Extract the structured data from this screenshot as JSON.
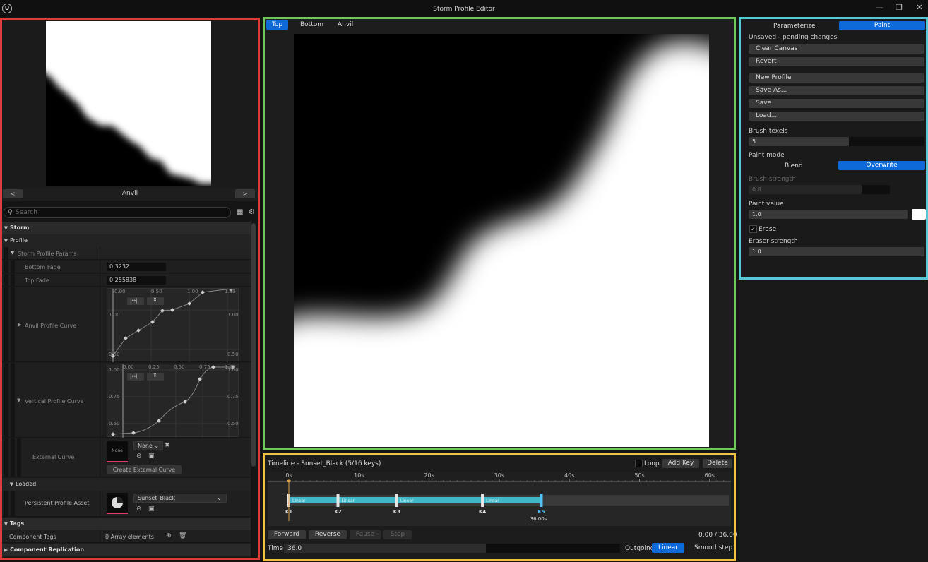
{
  "window": {
    "title": "Storm Profile Editor",
    "logo": "U",
    "minimize_glyph": "—",
    "restore_glyph": "❐",
    "close_glyph": "✕"
  },
  "left_panel": {
    "preview": {
      "name": "Anvil",
      "prev_label": "<",
      "next_label": ">"
    },
    "search": {
      "placeholder": "Search"
    },
    "categories": {
      "storm": "Storm",
      "profile": "Profile",
      "storm_profile_params": "Storm Profile Params",
      "loaded": "Loaded",
      "tags": "Tags",
      "component_replication": "Component Replication"
    },
    "properties": {
      "bottom_fade": {
        "label": "Bottom Fade",
        "value": "0.3232"
      },
      "top_fade": {
        "label": "Top Fade",
        "value": "0.255838"
      },
      "anvil_curve": {
        "label": "Anvil Profile Curve",
        "x_ticks": [
          "0.00",
          "0.50",
          "1.00",
          "1.50"
        ],
        "y_ticks": [
          "1.00",
          "0.50"
        ],
        "y_ticks_right": [
          "1.00",
          "0.50"
        ]
      },
      "vertical_curve": {
        "label": "Vertical Profile Curve",
        "x_ticks": [
          "0.00",
          "0.25",
          "0.50",
          "0.75",
          "1.00"
        ],
        "y_ticks": [
          "1.00",
          "0.75",
          "0.50"
        ],
        "y_ticks_right": [
          "1.00",
          "0.75",
          "0.50"
        ]
      },
      "external_curve": {
        "label": "External Curve",
        "thumb_text": "None",
        "combo_value": "None",
        "create_button": "Create External Curve"
      },
      "persistent_asset": {
        "label": "Persistent Profile Asset",
        "value": "Sunset_Black"
      },
      "component_tags": {
        "label": "Component Tags",
        "value": "0 Array elements"
      }
    }
  },
  "center": {
    "tabs": [
      "Top",
      "Bottom",
      "Anvil"
    ],
    "active_tab": 0
  },
  "timeline": {
    "title": "Timeline - Sunset_Black (5/16 keys)",
    "loop_label": "Loop",
    "add_key_label": "Add Key",
    "delete_label": "Delete",
    "ruler": [
      "0s",
      "10s",
      "20s",
      "30s",
      "40s",
      "50s",
      "60s"
    ],
    "keys": [
      {
        "label": "K1",
        "time": 0,
        "interp": "Linear"
      },
      {
        "label": "K2",
        "time": 7,
        "interp": "Linear"
      },
      {
        "label": "K3",
        "time": 15.4,
        "interp": "Linear"
      },
      {
        "label": "K4",
        "time": 27.6,
        "interp": "Linear"
      },
      {
        "label": "K5",
        "time": 36,
        "interp": ""
      }
    ],
    "selected_key_time_label": "36.00s",
    "buttons": {
      "forward": "Forward",
      "reverse": "Reverse",
      "pause": "Pause",
      "stop": "Stop"
    },
    "progress_text": "0.00 / 36.00",
    "time_label": "Time",
    "time_value": "36.0",
    "outgoing_label": "Outgoing",
    "interp_linear": "Linear",
    "interp_smoothstep": "Smoothstep",
    "accent": "#0e6ad8",
    "track_color": "#3fb7c6"
  },
  "right_panel": {
    "mode_parameterize": "Parameterize",
    "mode_paint": "Paint",
    "status": "Unsaved - pending changes",
    "buttons": {
      "clear_canvas": "Clear Canvas",
      "revert": "Revert",
      "new_profile": "New Profile",
      "save_as": "Save As...",
      "save": "Save",
      "load": "Load..."
    },
    "brush_texels": {
      "label": "Brush texels",
      "value": "5",
      "fraction": 0.57
    },
    "paint_mode": {
      "label": "Paint mode",
      "blend": "Blend",
      "overwrite": "Overwrite"
    },
    "brush_strength": {
      "label": "Brush strength",
      "value": "0.8",
      "fraction": 0.8
    },
    "paint_value": {
      "label": "Paint value",
      "value": "1.0",
      "color": "#ffffff"
    },
    "erase": {
      "label": "Erase",
      "checked": true,
      "check_glyph": "✓"
    },
    "eraser_strength": {
      "label": "Eraser strength",
      "value": "1.0",
      "fraction": 1.0
    }
  }
}
